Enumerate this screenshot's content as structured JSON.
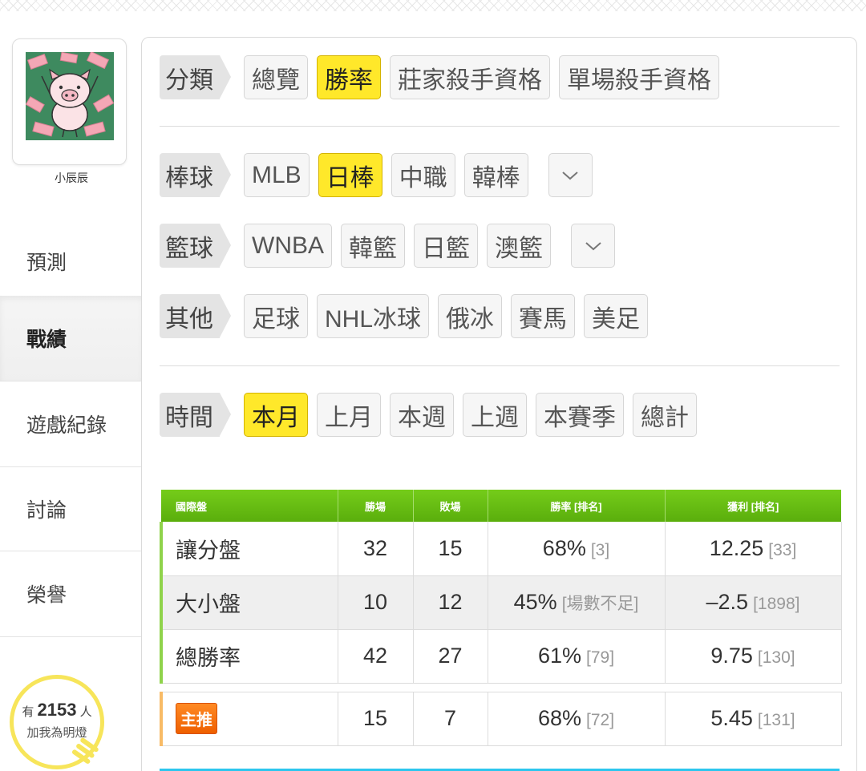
{
  "user": {
    "name": "小辰辰"
  },
  "nav": {
    "items": [
      {
        "label": "預測"
      },
      {
        "label": "戰績"
      },
      {
        "label": "遊戲紀錄"
      },
      {
        "label": "討論"
      },
      {
        "label": "榮譽"
      }
    ],
    "active": "戰績"
  },
  "lamp": {
    "prefix": "有",
    "count": "2153",
    "suffix": "人",
    "text": "加我為明燈"
  },
  "filters": {
    "category": {
      "label": "分類",
      "options": [
        "總覽",
        "勝率",
        "莊家殺手資格",
        "單場殺手資格"
      ],
      "selected": "勝率"
    },
    "baseball": {
      "label": "棒球",
      "options": [
        "MLB",
        "日棒",
        "中職",
        "韓棒"
      ],
      "selected": "日棒"
    },
    "basketball": {
      "label": "籃球",
      "options": [
        "WNBA",
        "韓籃",
        "日籃",
        "澳籃"
      ]
    },
    "other": {
      "label": "其他",
      "options": [
        "足球",
        "NHL冰球",
        "俄冰",
        "賽馬",
        "美足"
      ]
    },
    "time": {
      "label": "時間",
      "options": [
        "本月",
        "上月",
        "本週",
        "上週",
        "本賽季",
        "總計"
      ],
      "selected": "本月"
    }
  },
  "table": {
    "headers": [
      "國際盤",
      "勝場",
      "敗場",
      "勝率 [排名]",
      "獲利 [排名]"
    ],
    "rows": [
      {
        "name": "讓分盤",
        "win": "32",
        "lose": "15",
        "rate": "68%",
        "rate_rank": "[3]",
        "profit": "12.25",
        "profit_rank": "[33]"
      },
      {
        "name": "大小盤",
        "win": "10",
        "lose": "12",
        "rate": "45%",
        "rate_rank": "[場數不足]",
        "profit": "–2.5",
        "profit_rank": "[1898]"
      },
      {
        "name": "總勝率",
        "win": "42",
        "lose": "27",
        "rate": "61%",
        "rate_rank": "[79]",
        "profit": "9.75",
        "profit_rank": "[130]"
      }
    ],
    "featured": {
      "badge": "主推",
      "win": "15",
      "lose": "7",
      "rate": "68%",
      "rate_rank": "[72]",
      "profit": "5.45",
      "profit_rank": "[131]"
    }
  },
  "colors": {
    "highlight": "#ffe82a",
    "header_green": "#5aae0c",
    "badge_orange": "#ee5f00",
    "lamp_yellow": "#f7e55a",
    "bottom_bar": "#2cc6ee"
  }
}
